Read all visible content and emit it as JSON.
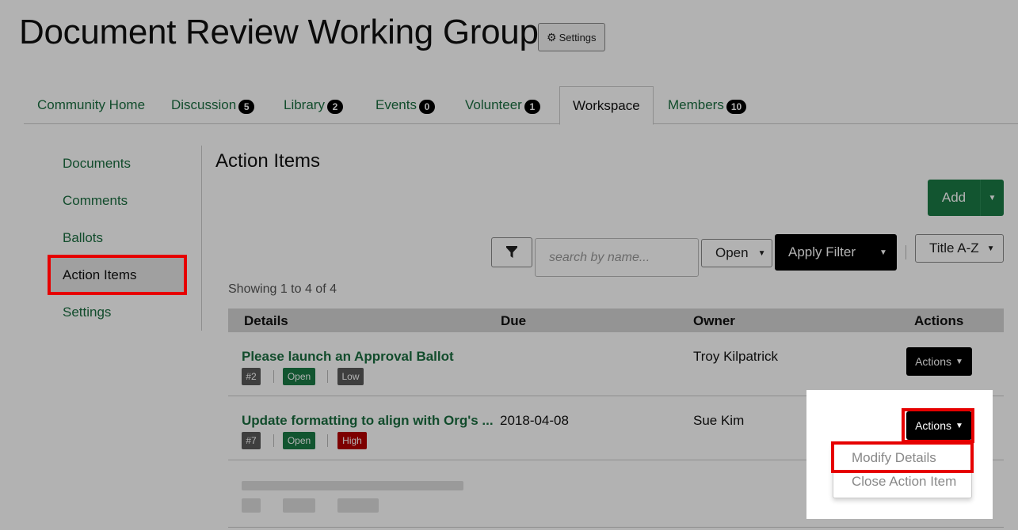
{
  "page_title": "Document Review Working Group",
  "settings_label": "Settings",
  "tabs": [
    {
      "label": "Community Home",
      "count": ""
    },
    {
      "label": "Discussion",
      "count": "5"
    },
    {
      "label": "Library",
      "count": "2"
    },
    {
      "label": "Events",
      "count": "0"
    },
    {
      "label": "Volunteer",
      "count": "1"
    },
    {
      "label": "Workspace",
      "count": ""
    },
    {
      "label": "Members",
      "count": "10"
    }
  ],
  "sidebar": {
    "items": [
      {
        "label": "Documents"
      },
      {
        "label": "Comments"
      },
      {
        "label": "Ballots"
      },
      {
        "label": "Action Items"
      },
      {
        "label": "Settings"
      }
    ]
  },
  "section_title": "Action Items",
  "add_label": "Add",
  "filters": {
    "search_placeholder": "search by name...",
    "status_value": "Open",
    "apply_label": "Apply Filter",
    "sort_value": "Title A-Z"
  },
  "showing": "Showing 1 to 4 of 4",
  "columns": [
    "Details",
    "Due",
    "Owner",
    "Actions"
  ],
  "rows": [
    {
      "title": "Please launch an Approval Ballot",
      "due": "",
      "owner": "Troy Kilpatrick",
      "id": "#2",
      "status": "Open",
      "priority": "Low",
      "actions_label": "Actions"
    },
    {
      "title": "Update formatting to align with Org's ...",
      "due": "2018-04-08",
      "owner": "Sue Kim",
      "id": "#7",
      "status": "Open",
      "priority": "High",
      "actions_label": "Actions"
    }
  ],
  "dropdown": {
    "items": [
      "Modify Details",
      "Close Action Item"
    ]
  },
  "colors": {
    "link_green": "#1a6e40",
    "status_open": "#1a7a45",
    "priority_low": "#5a5a5a",
    "priority_high": "#b30000",
    "id_tag": "#5a5a5a",
    "highlight": "#e60000"
  }
}
